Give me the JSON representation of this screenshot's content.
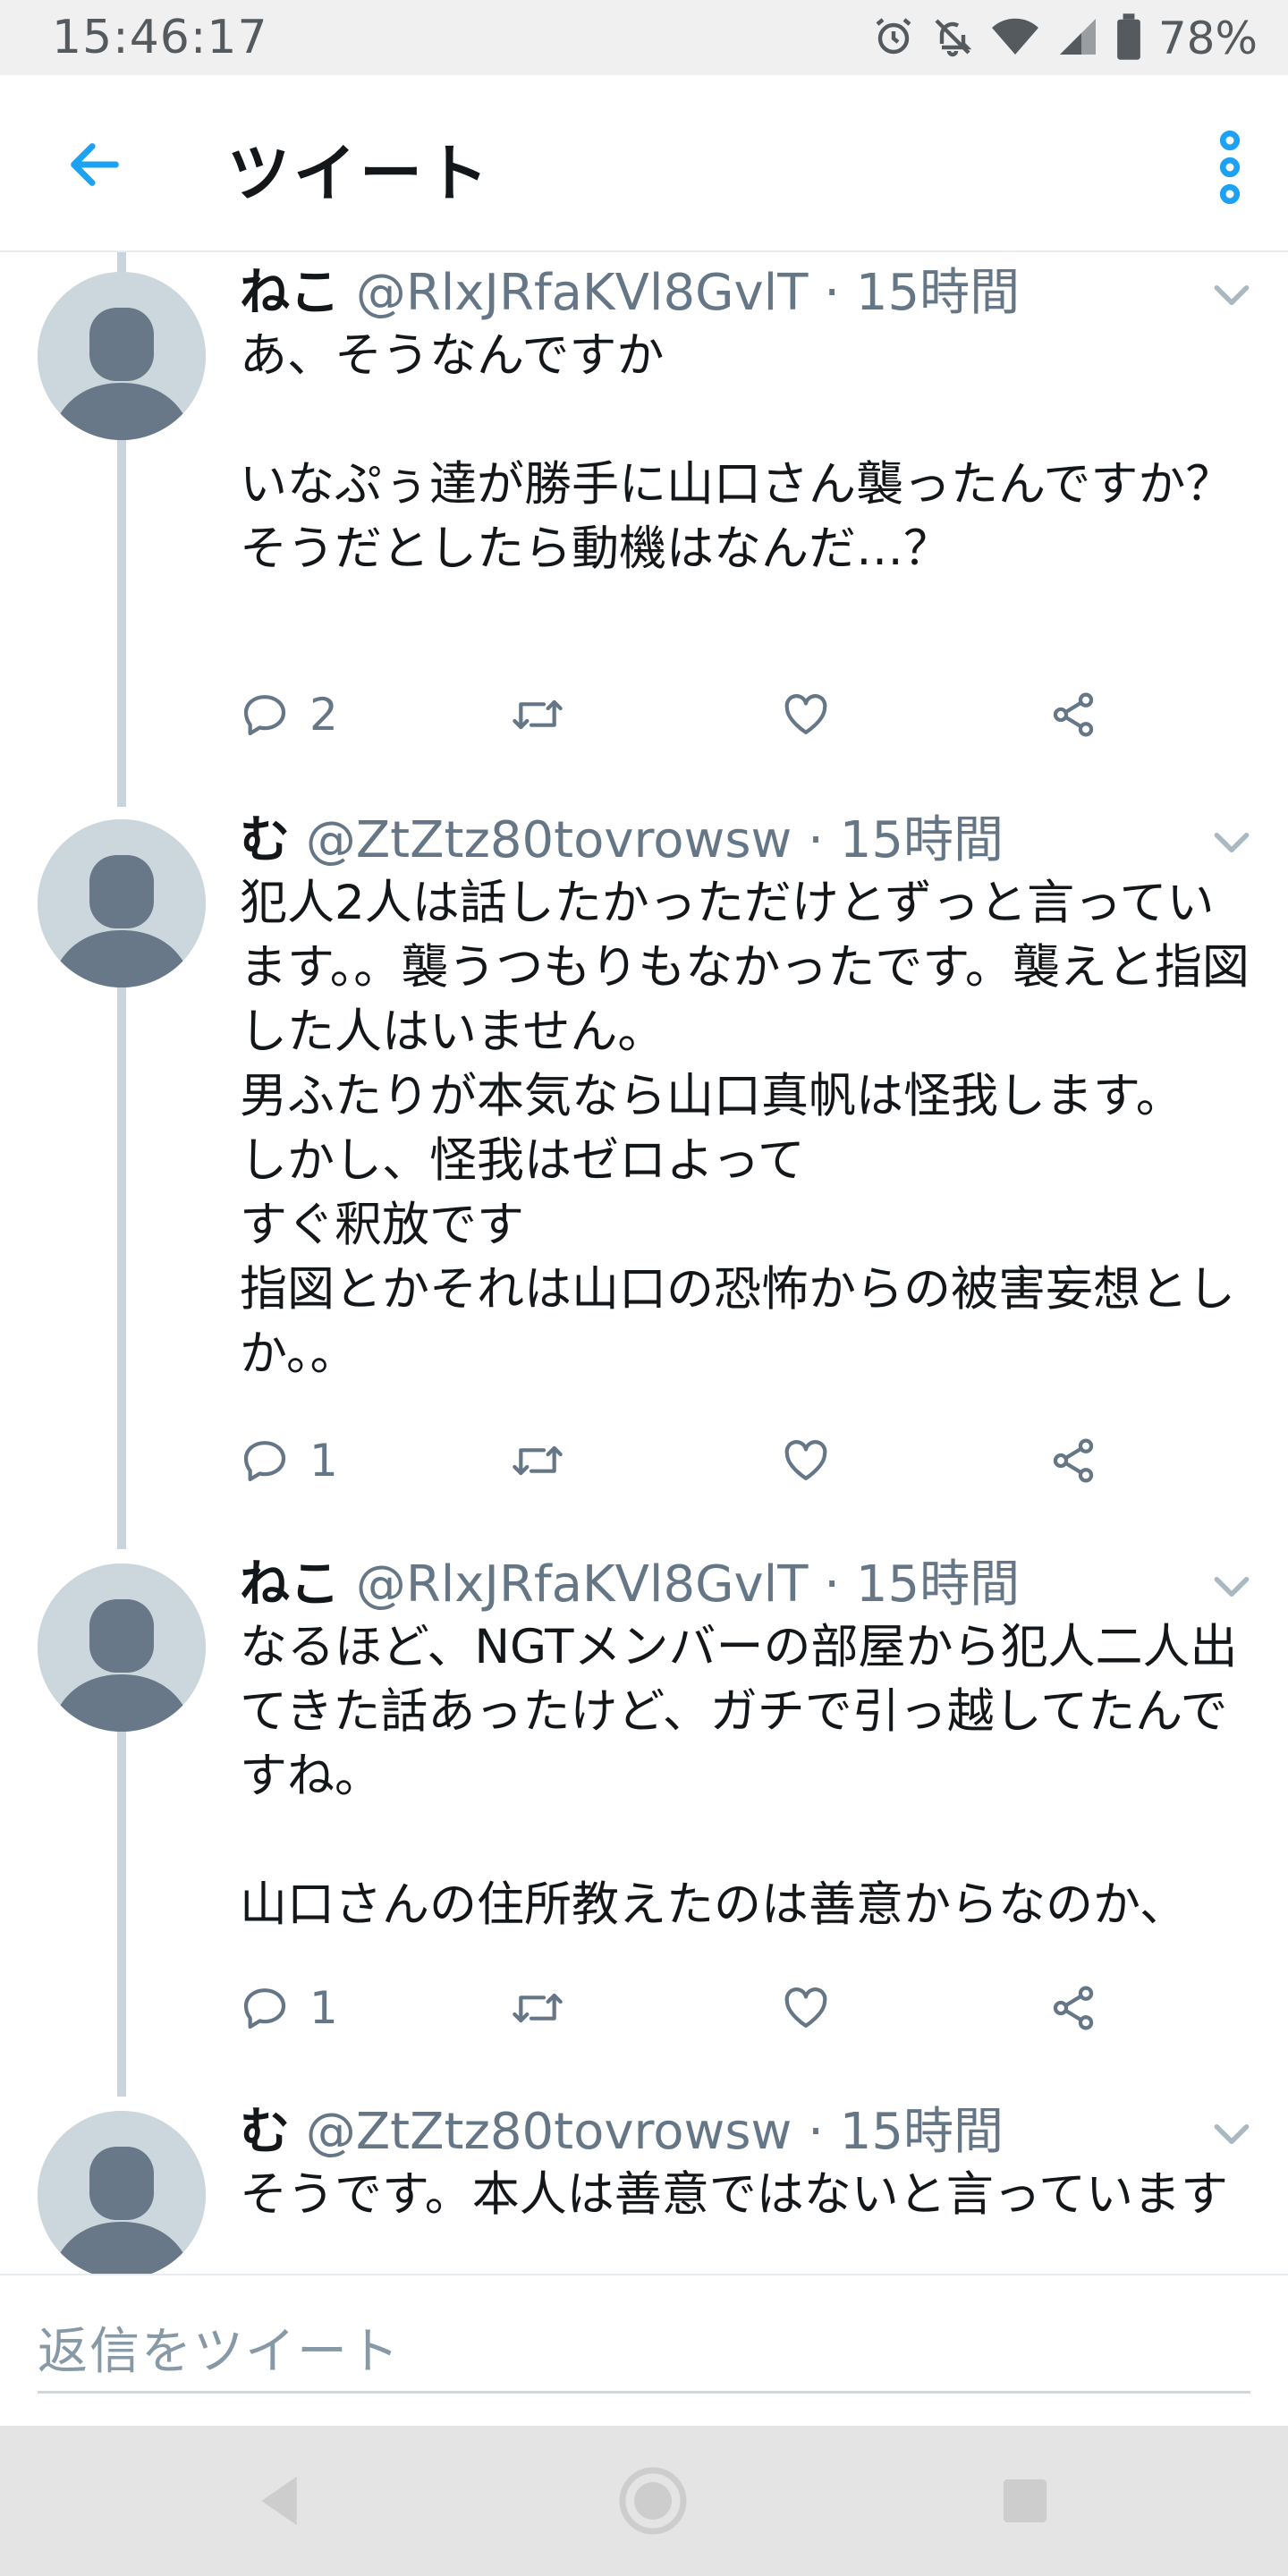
{
  "status_bar": {
    "time": "15:46:17",
    "battery": "78%",
    "icons": [
      "alarm-icon",
      "mute-icon",
      "wifi-icon",
      "signal-icon",
      "battery-icon"
    ]
  },
  "app_bar": {
    "title": "ツイート",
    "back_icon": "arrow-left-icon",
    "menu_icon": "more-vertical-icon",
    "accent": "#1da1f2"
  },
  "tweets": [
    {
      "name": "ねこ",
      "handle": "@RlxJRfaKVl8GvlT",
      "time": "· 15時間",
      "text": "あ、そうなんですか\n\nいなぷぅ達が勝手に山口さん襲ったんですか？\nそうだとしたら動機はなんだ…？",
      "reply_count": "2",
      "retweet_count": "",
      "like_count": ""
    },
    {
      "name": "む",
      "handle": "@ZtZtz80tovrowsw",
      "time": "· 15時間",
      "text": "犯人2人は話したかっただけとずっと言っています。。襲うつもりもなかったです。襲えと指図した人はいません。\n男ふたりが本気なら山口真帆は怪我します。\nしかし、怪我はゼロよって\nすぐ釈放です\n指図とかそれは山口の恐怖からの被害妄想としか。。",
      "reply_count": "1",
      "retweet_count": "",
      "like_count": ""
    },
    {
      "name": "ねこ",
      "handle": "@RlxJRfaKVl8GvlT",
      "time": "· 15時間",
      "text": "なるほど、NGTメンバーの部屋から犯人二人出てきた話あったけど、ガチで引っ越してたんですね。\n\n山口さんの住所教えたのは善意からなのか、",
      "reply_count": "1",
      "retweet_count": "",
      "like_count": ""
    },
    {
      "name": "む",
      "handle": "@ZtZtz80tovrowsw",
      "time": "· 15時間",
      "text": "そうです。本人は善意ではないと言っています",
      "reply_count": "",
      "retweet_count": "",
      "like_count": ""
    }
  ],
  "composer": {
    "placeholder": "返信をツイート"
  },
  "nav_bar": {
    "buttons": [
      "back-triangle-icon",
      "home-circle-icon",
      "recents-square-icon"
    ]
  },
  "colors": {
    "text_primary": "#14171a",
    "text_secondary": "#657786",
    "thread_line": "#c9d4dc",
    "avatar_bg": "#ccd6dd",
    "avatar_fg": "#687889"
  }
}
